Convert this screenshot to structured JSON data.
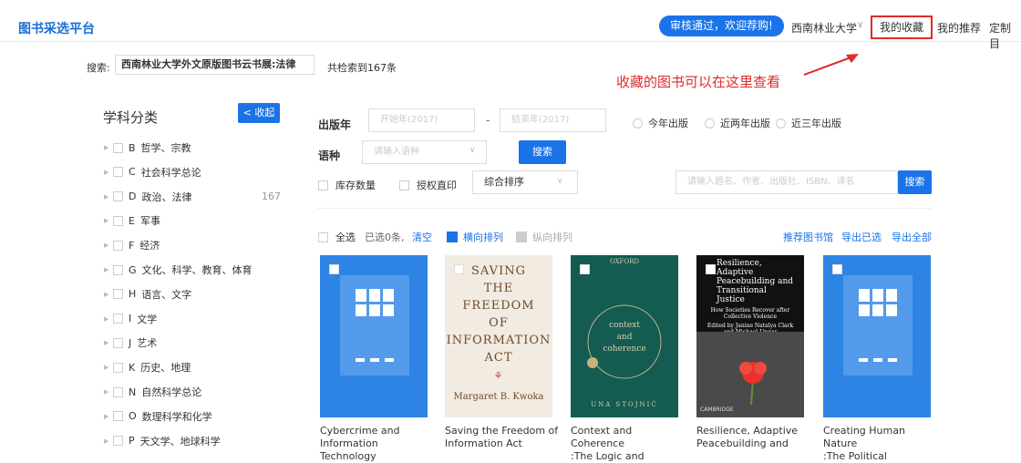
{
  "header": {
    "logo": "图书采选平台",
    "announcement": "审核通过，欢迎荐购!",
    "university": "西南林业大学",
    "nav": [
      "我的收藏",
      "我的推荐",
      "定制目"
    ]
  },
  "search": {
    "label": "搜索:",
    "query": "西南林业大学外文原版图书云书展:法律",
    "count": "共检索到167条"
  },
  "annotation": "收藏的图书可以在这里查看",
  "sidebar": {
    "title": "学科分类",
    "collapse_label": "< 收起",
    "categories": [
      {
        "code": "B",
        "label": "哲学、宗教",
        "count": ""
      },
      {
        "code": "C",
        "label": "社会科学总论",
        "count": ""
      },
      {
        "code": "D",
        "label": "政治、法律",
        "count": "167"
      },
      {
        "code": "E",
        "label": "军事",
        "count": ""
      },
      {
        "code": "F",
        "label": "经济",
        "count": ""
      },
      {
        "code": "G",
        "label": "文化、科学、教育、体育",
        "count": ""
      },
      {
        "code": "H",
        "label": "语言、文字",
        "count": ""
      },
      {
        "code": "I",
        "label": "文学",
        "count": ""
      },
      {
        "code": "J",
        "label": "艺术",
        "count": ""
      },
      {
        "code": "K",
        "label": "历史、地理",
        "count": ""
      },
      {
        "code": "N",
        "label": "自然科学总论",
        "count": ""
      },
      {
        "code": "O",
        "label": "数理科学和化学",
        "count": ""
      },
      {
        "code": "P",
        "label": "天文学、地球科学",
        "count": ""
      }
    ]
  },
  "filters": {
    "year_label": "出版年",
    "year_start_placeholder": "开始年(2017)",
    "year_end_placeholder": "结束年(2017)",
    "radios": [
      "今年出版",
      "近两年出版",
      "近三年出版"
    ],
    "lang_label": "语种",
    "lang_placeholder": "请输入语种",
    "search_btn": "搜索",
    "stock_label": "库存数量",
    "auth_label": "授权直印",
    "sort_value": "综合排序",
    "keyword_placeholder": "请输入题名、作者、出版社、ISBN、译名",
    "keyword_btn": "搜索"
  },
  "toolbar": {
    "select_all": "全选",
    "selected": "已选0条,",
    "clear": "清空",
    "horizontal": "横向排列",
    "vertical": "纵向排列",
    "recommend_lib": "推荐图书馆",
    "export_selected": "导出已选",
    "export_all": "导出全部"
  },
  "books": [
    {
      "title_line1": "Cybercrime and",
      "title_line2": "Information Technology"
    },
    {
      "title_line1": "Saving the Freedom of",
      "title_line2": "Information Act",
      "cover": {
        "lines": [
          "SAVING",
          "THE",
          "FREEDOM",
          "OF",
          "INFORMATION",
          "ACT"
        ],
        "ornament": "⚘",
        "author": "Margaret B. Kwoka"
      }
    },
    {
      "title_line1": "Context and Coherence",
      "title_line2": ":The Logic and",
      "cover": {
        "publisher": "OXFORD",
        "main": "context",
        "and": "and",
        "sub": "coherence",
        "author": "UNA STOJNIĆ"
      }
    },
    {
      "title_line1": "Resilience, Adaptive",
      "title_line2": "Peacebuilding and",
      "cover": {
        "title": "Resilience, Adaptive Peacebuilding and Transitional Justice",
        "subtitle": "How Societies Recover after Collective Violence",
        "editors": "Edited by Janine Natalya Clark and Michael Ungar",
        "publisher": "CAMBRIDGE"
      }
    },
    {
      "title_line1": "Creating Human Nature",
      "title_line2": ":The Political"
    }
  ],
  "colors": {
    "primary": "#1a73e8",
    "annotation": "#e02b2b"
  }
}
